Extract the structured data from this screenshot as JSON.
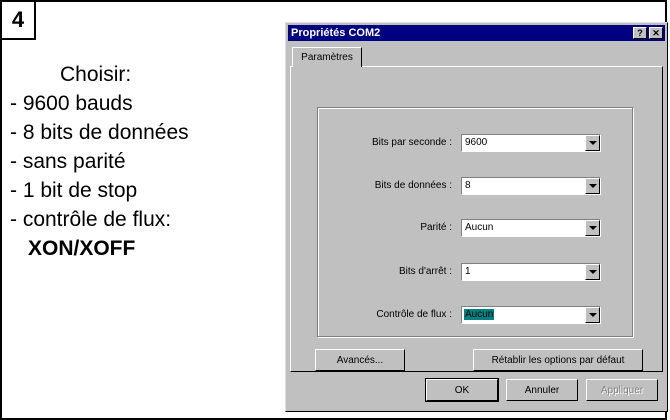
{
  "step_number": "4",
  "instructions": {
    "heading": "Choisir:",
    "items": [
      "- 9600 bauds",
      "- 8 bits de données",
      "- sans parité",
      "- 1 bit de stop",
      "- contrôle de flux:"
    ],
    "flow_value": "XON/XOFF"
  },
  "dialog": {
    "title": "Propriétés COM2",
    "help_button": "?",
    "close_button": "✕",
    "tab_label": "Paramètres",
    "fields": [
      {
        "label": "Bits par seconde :",
        "value": "9600"
      },
      {
        "label": "Bits de données :",
        "value": "8"
      },
      {
        "label": "Parité :",
        "value": "Aucun"
      },
      {
        "label": "Bits d'arrêt :",
        "value": "1"
      },
      {
        "label": "Contrôle de flux :",
        "value": "Aucun"
      }
    ],
    "advanced_button": "Avancés...",
    "restore_button": "Rétablir les options par défaut",
    "ok_button": "OK",
    "cancel_button": "Annuler",
    "apply_button": "Appliquer"
  }
}
